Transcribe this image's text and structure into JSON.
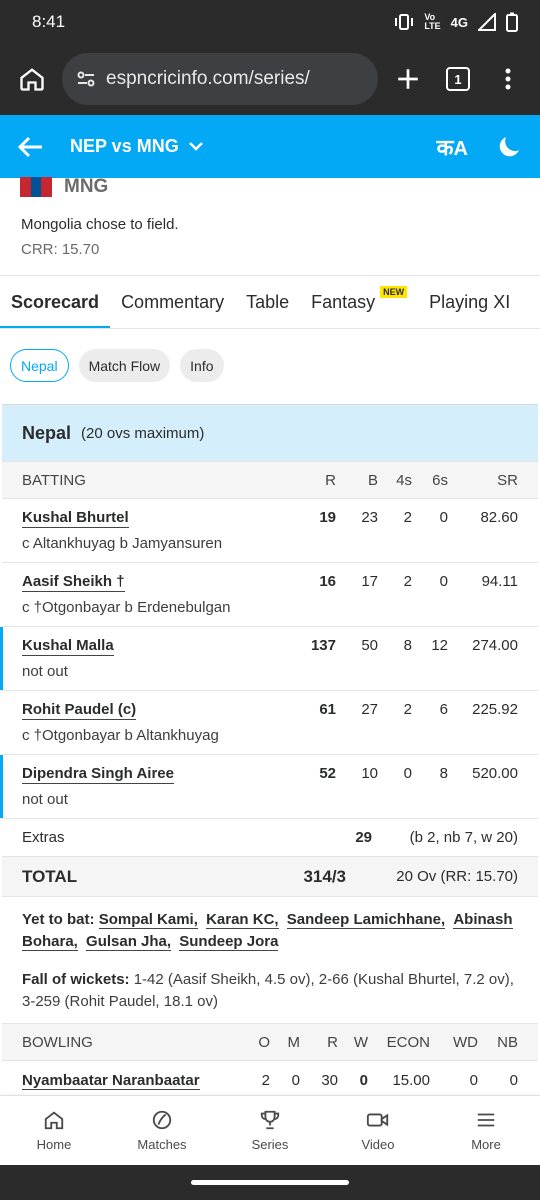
{
  "status": {
    "time": "8:41",
    "network": "4G",
    "volte": "Vo\nLTE"
  },
  "browser": {
    "url": "espncricinfo.com/series/",
    "tab_count": "1"
  },
  "appbar": {
    "title": "NEP vs MNG"
  },
  "team_line": {
    "code": "MNG",
    "flag_colors": [
      "#c4272f",
      "#015197",
      "#c4272f"
    ]
  },
  "match_info": {
    "toss": "Mongolia chose to field.",
    "crr": "CRR: 15.70"
  },
  "tabs": [
    {
      "label": "Scorecard"
    },
    {
      "label": "Commentary"
    },
    {
      "label": "Table"
    },
    {
      "label": "Fantasy",
      "badge": "NEW"
    },
    {
      "label": "Playing XI"
    }
  ],
  "chips": [
    "Nepal",
    "Match Flow",
    "Info"
  ],
  "innings": {
    "team": "Nepal",
    "overs": "(20 ovs maximum)",
    "batting_headers": {
      "name": "BATTING",
      "r": "R",
      "b": "B",
      "fours": "4s",
      "sixes": "6s",
      "sr": "SR"
    },
    "batters": [
      {
        "name": "Kushal Bhurtel",
        "dismissal": "c Altankhuyag b Jamyansuren",
        "r": "19",
        "b": "23",
        "fours": "2",
        "sixes": "0",
        "sr": "82.60"
      },
      {
        "name": "Aasif Sheikh †",
        "dismissal": "c †Otgonbayar b Erdenebulgan",
        "r": "16",
        "b": "17",
        "fours": "2",
        "sixes": "0",
        "sr": "94.11"
      },
      {
        "name": "Kushal Malla",
        "dismissal": "not out",
        "r": "137",
        "b": "50",
        "fours": "8",
        "sixes": "12",
        "sr": "274.00"
      },
      {
        "name": "Rohit Paudel (c)",
        "dismissal": "c †Otgonbayar b Altankhuyag",
        "r": "61",
        "b": "27",
        "fours": "2",
        "sixes": "6",
        "sr": "225.92"
      },
      {
        "name": "Dipendra Singh Airee",
        "dismissal": "not out",
        "r": "52",
        "b": "10",
        "fours": "0",
        "sixes": "8",
        "sr": "520.00"
      }
    ],
    "extras": {
      "label": "Extras",
      "value": "29",
      "detail": "(b 2, nb 7, w 20)"
    },
    "total": {
      "label": "TOTAL",
      "value": "314/3",
      "overs": "20 Ov (RR: 15.70)"
    },
    "yet_to_bat": {
      "label": "Yet to bat:",
      "players": [
        "Sompal Kami,",
        "Karan KC,",
        "Sandeep Lamichhane,",
        "Abinash Bohara,",
        "Gulsan Jha,",
        "Sundeep Jora"
      ]
    },
    "fall_of_wickets": {
      "label": "Fall of wickets:",
      "text": "1-42 (Aasif Sheikh, 4.5 ov), 2-66 (Kushal Bhurtel, 7.2 ov), 3-259 (Rohit Paudel, 18.1 ov)"
    },
    "bowling_headers": {
      "name": "BOWLING",
      "o": "O",
      "m": "M",
      "r": "R",
      "w": "W",
      "econ": "ECON",
      "wd": "WD",
      "nb": "NB"
    },
    "bowlers": [
      {
        "name": "Nyambaatar Naranbaatar",
        "o": "2",
        "m": "0",
        "r": "30",
        "w": "0",
        "econ": "15.00",
        "wd": "0",
        "nb": "0"
      }
    ]
  },
  "bottom_nav": [
    {
      "label": "Home",
      "icon": "home-icon"
    },
    {
      "label": "Matches",
      "icon": "ball-icon"
    },
    {
      "label": "Series",
      "icon": "trophy-icon"
    },
    {
      "label": "Video",
      "icon": "video-icon"
    },
    {
      "label": "More",
      "icon": "menu-icon"
    }
  ],
  "colors": {
    "accent": "#03a9f4",
    "header_bg": "#2b2b2b",
    "innings_bg": "#d4eefb",
    "new_badge": "#ffe500"
  }
}
